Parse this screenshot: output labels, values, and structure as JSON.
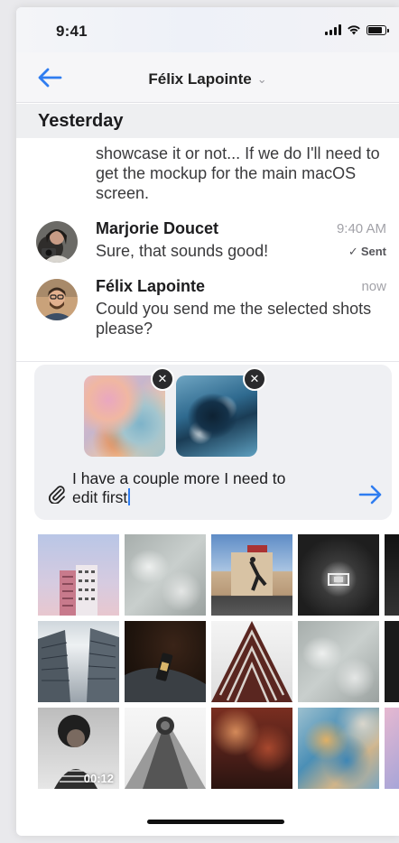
{
  "status_bar": {
    "time": "9:41",
    "icons": [
      "signal-icon",
      "wifi-icon",
      "battery-icon"
    ],
    "battery_level": 0.85
  },
  "nav": {
    "back_icon": "back-arrow-icon",
    "title": "Félix Lapointe",
    "chevron": "⌄"
  },
  "section": {
    "title": "Yesterday"
  },
  "messages": {
    "partial_text": "showcase it or not... If we do I'll need to get the mockup for the main macOS screen.",
    "items": [
      {
        "sender": "Marjorie Doucet",
        "time": "9:40 AM",
        "text": "Sure, that sounds good!",
        "status": "Sent",
        "status_icon": "checkmark-icon"
      },
      {
        "sender": "Félix Lapointe",
        "time": "now",
        "text": "Could you send me the selected shots please?"
      }
    ]
  },
  "composer": {
    "attachments": [
      "attachment-abstract-paint",
      "attachment-aerial-coast"
    ],
    "remove_icon": "✕",
    "text": "I have a couple more I need to edit first",
    "attach_icon": "paperclip-icon",
    "send_icon": "send-arrow-icon"
  },
  "photos": {
    "video_duration": "00:12",
    "count": 15
  },
  "colors": {
    "accent": "#2f7df0",
    "background": "#ffffff",
    "composer_bg": "#eff0f3",
    "muted_text": "#a2a2a8"
  }
}
